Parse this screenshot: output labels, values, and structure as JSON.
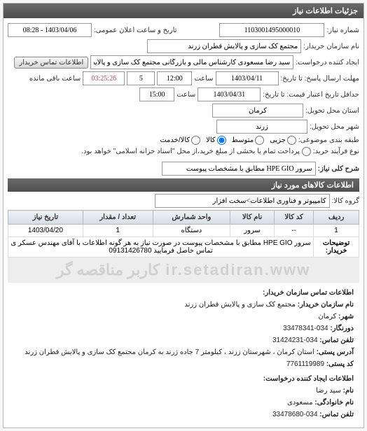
{
  "panel_title": "جزئیات اطلاعات نیاز",
  "fields": {
    "number_label": "شماره نیاز:",
    "number_value": "1103001495000010",
    "public_date_label": "تاریخ و ساعت اعلان عمومی:",
    "public_date_value": "1403/04/06 - 08:28",
    "buyer_label": "نام سازمان خریدار:",
    "buyer_value": "مجتمع کک سازی و پالایش قطران زرند",
    "requester_label": "ایجاد کننده درخواست:",
    "requester_value": "سید رضا مسعودی کارشناس مالی و بازرگانی مجتمع کک سازی و پالایش قطرا",
    "contact_btn": "اطلاعات تماس خریدار",
    "deadline_until_label": "مهلت ارسال پاسخ: تا تاریخ:",
    "deadline_date": "1403/04/11",
    "time_label": "ساعت",
    "deadline_time": "12:00",
    "remain_label5": "5",
    "remain_time": "03:25:26",
    "remain_text": "ساعت باقی مانده",
    "validity_label": "حداقل تاریخ اعتبار قیمت: تا تاریخ:",
    "validity_date": "1403/04/31",
    "validity_time": "15:00",
    "province_label": "استان محل تحویل:",
    "province_value": "کرمان",
    "city_label": "شهر محل تحویل:",
    "city_value": "زرند",
    "packaging_label": "طبقه بندی موضوعی:",
    "pkg1": "جزیی",
    "pkg2": "متوسط",
    "pkg3": "کالا",
    "pkg4": "کالا/خدمت",
    "process_label": "نوع فرآیند خرید:",
    "process_text": "پرداخت تمام یا بخشی از مبلغ خرید،از محل \"اسناد خزانه اسلامی\" خواهد بود.",
    "brief_label": "شرح کلی نیاز:",
    "brief_value": "سرور HPE GIO مطابق با مشخصات پیوست",
    "items_header": "اطلاعات کالاهای مورد نیاز",
    "group_label": "گروه کالا:",
    "group_value": "کامپیوتر و فناوری اطلاعات>سخت افزار"
  },
  "table": {
    "headers": [
      "ردیف",
      "کد کالا",
      "نام کالا",
      "واحد شمارش",
      "تعداد / مقدار",
      "تاریخ نیاز"
    ],
    "rows": [
      {
        "idx": "1",
        "code": "--",
        "name": "سرور",
        "unit": "دستگاه",
        "qty": "1",
        "date": "1403/04/20"
      }
    ],
    "note_label": "توضیحات خریدار:",
    "note_text": "سرور HPE GIO مطابق با مشخصات پیوست در صورت نیاز به هر گونه اطلاعات با آقای مهندس عسکر ی تماس حاصل فرمایید 09131426780"
  },
  "watermark": "ir.setadiran.www کاربر مناقصه گر",
  "contact_info": {
    "header1": "اطلاعات تماس سازمان خریدار:",
    "org_label": "نام سازمان خریدار:",
    "org_val": "مجتمع کک سازی و پالایش قطران زرند",
    "city_label": "شهر:",
    "city_val": "کرمان",
    "fax_label": "دورنگار:",
    "fax_val": "034-33478341",
    "phone_label": "تلفن تماس:",
    "phone_val": "034-31424231",
    "addr_label": "آدرس پستی:",
    "addr_val": "استان کرمان ، شهرستان زرند ، کیلومتر 7 جاده زرند به کرمان مجتمع کک سازی و پالایش قطران زرند",
    "post_label": "کد پستی:",
    "post_val": "7761119989",
    "header2": "اطلاعات ایجاد کننده درخواست:",
    "name_label": "نام:",
    "name_val": "سید رضا",
    "family_label": "نام خانوادگی:",
    "family_val": "مسعودی",
    "phone2_label": "تلفن تماس:",
    "phone2_val": "034-33478680"
  }
}
